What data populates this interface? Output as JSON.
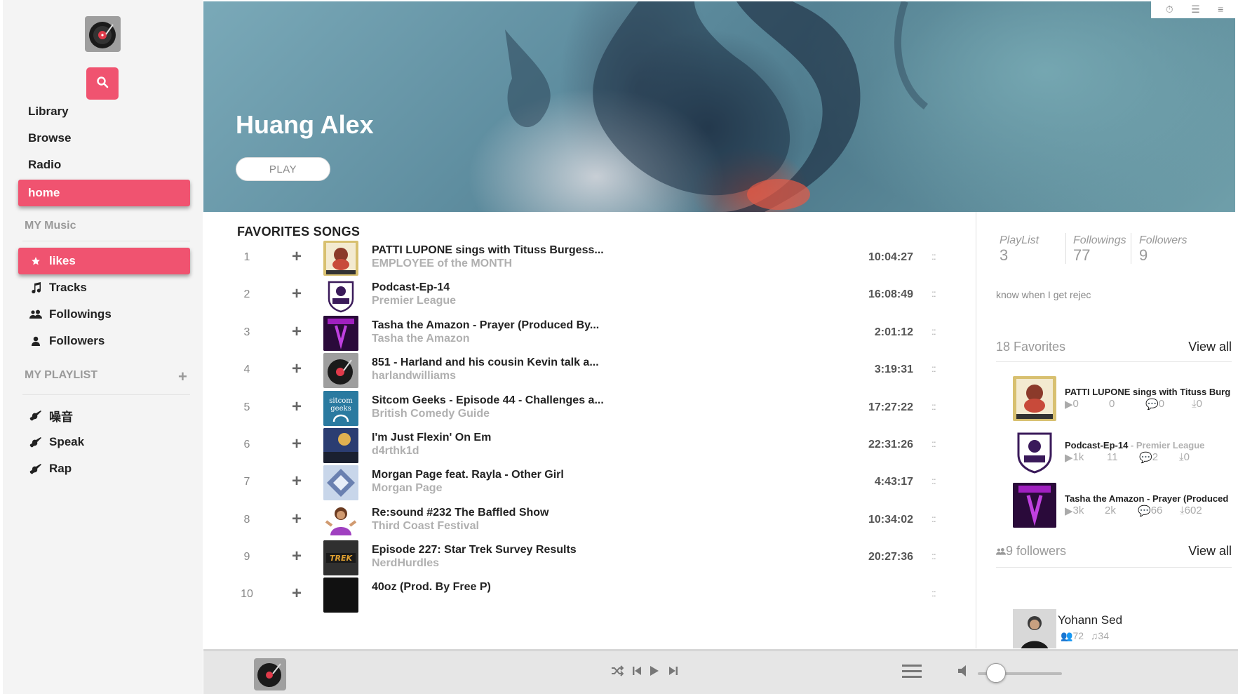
{
  "sidebar": {
    "nav": [
      {
        "label": "Library",
        "active": false
      },
      {
        "label": "Browse",
        "active": false
      },
      {
        "label": "Radio",
        "active": false
      },
      {
        "label": "home",
        "active": true
      }
    ],
    "my_music_label": "MY Music",
    "music_items": [
      {
        "label": "likes",
        "icon": "star-icon",
        "active": true
      },
      {
        "label": "Tracks",
        "icon": "music-note-icon",
        "active": false
      },
      {
        "label": "Followings",
        "icon": "users-icon",
        "active": false
      },
      {
        "label": "Followers",
        "icon": "user-icon",
        "active": false
      }
    ],
    "playlist_label": "MY PLAYLIST",
    "playlists": [
      {
        "label": "噪音",
        "icon": "guitar-icon"
      },
      {
        "label": "Speak",
        "icon": "guitar-icon"
      },
      {
        "label": "Rap",
        "icon": "guitar-icon"
      }
    ]
  },
  "hero": {
    "title": "Huang Alex",
    "play_label": "PLAY"
  },
  "favorites": {
    "heading": "FAVORITES SONGS",
    "songs": [
      {
        "num": "1",
        "title": "PATTI LUPONE sings with Tituss Burgess...",
        "artist": "EMPLOYEE of the MONTH",
        "duration": "10:04:27"
      },
      {
        "num": "2",
        "title": "Podcast-Ep-14",
        "artist": "Premier League",
        "duration": "16:08:49"
      },
      {
        "num": "3",
        "title": "Tasha the Amazon - Prayer (Produced By...",
        "artist": "Tasha the Amazon",
        "duration": "2:01:12"
      },
      {
        "num": "4",
        "title": "851 - Harland and his cousin Kevin talk a...",
        "artist": "harlandwilliams",
        "duration": "3:19:31"
      },
      {
        "num": "5",
        "title": "Sitcom Geeks - Episode 44 - Challenges a...",
        "artist": "British Comedy Guide",
        "duration": "17:27:22"
      },
      {
        "num": "6",
        "title": "I'm Just Flexin' On Em",
        "artist": "d4rthk1d",
        "duration": "22:31:26"
      },
      {
        "num": "7",
        "title": "Morgan Page feat. Rayla - Other Girl",
        "artist": "Morgan Page",
        "duration": "4:43:17"
      },
      {
        "num": "8",
        "title": "Re:sound #232 The Baffled Show",
        "artist": "Third Coast Festival",
        "duration": "10:34:02"
      },
      {
        "num": "9",
        "title": "Episode 227: Star Trek Survey Results",
        "artist": "NerdHurdles",
        "duration": "20:27:36"
      },
      {
        "num": "10",
        "title": "40oz (Prod. By Free P)",
        "artist": "",
        "duration": ""
      }
    ]
  },
  "profile": {
    "stats": [
      {
        "label": "PlayList",
        "value": "3"
      },
      {
        "label": "Followings",
        "value": "77"
      },
      {
        "label": "Followers",
        "value": "9"
      }
    ],
    "bio": "know when I get rejec",
    "favorites_count_label": "18 Favorites",
    "view_all": "View all",
    "favorites": [
      {
        "title": "PATTI LUPONE sings with Tituss Burg",
        "sub": "",
        "plays": "0",
        "likes": "0",
        "comments": "0",
        "downloads": "0"
      },
      {
        "title": "Podcast-Ep-14",
        "sub": " - Premier League",
        "plays": "1k",
        "likes": "11",
        "comments": "2",
        "downloads": "0"
      },
      {
        "title": "Tasha the Amazon - Prayer (Produced",
        "sub": "",
        "plays": "3k",
        "likes": "2k",
        "comments": "66",
        "downloads": "602"
      }
    ],
    "followers_label": "9 followers",
    "followers_view_all": "View all",
    "follower": {
      "name": "Yohann Sed",
      "followers": "72",
      "tracks": "34"
    }
  },
  "colors": {
    "accent": "#f05370"
  }
}
